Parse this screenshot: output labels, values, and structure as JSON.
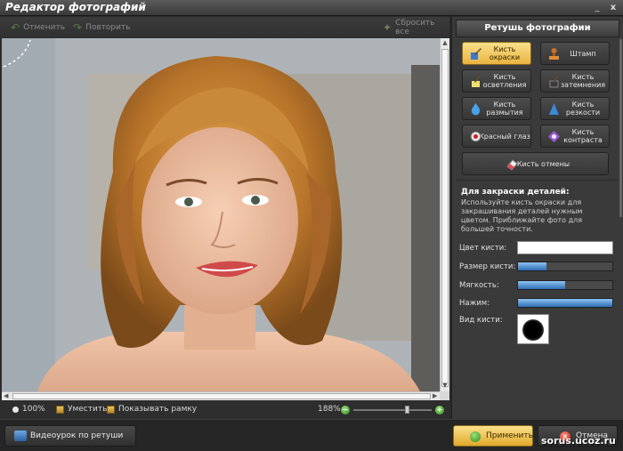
{
  "window": {
    "title": "Редактор фотографий",
    "minimize": "_",
    "close": "x"
  },
  "toolbar": {
    "undo": "Отменить",
    "redo": "Повторить",
    "reset": "Сбросить все"
  },
  "status": {
    "zoom_100": "100%",
    "fit": "Уместить",
    "show_frame": "Показывать рамку",
    "zoom_value": "188%",
    "zoom_level_fraction": 0.7
  },
  "bottom": {
    "video_tutorial": "Видеоурок по ретуши",
    "apply": "Применить",
    "cancel": "Отмена",
    "watermark": "sorus.ucoz.ru"
  },
  "panel": {
    "title": "Ретушь фотографии",
    "tools": [
      {
        "label": "Кисть окраски",
        "icon": "paint-brush-icon",
        "active": true
      },
      {
        "label": "Штамп",
        "icon": "stamp-icon",
        "active": false
      },
      {
        "label": "Кисть осветления",
        "icon": "lighten-brush-icon",
        "active": false
      },
      {
        "label": "Кисть затемнения",
        "icon": "darken-brush-icon",
        "active": false
      },
      {
        "label": "Кисть размытия",
        "icon": "blur-drop-icon",
        "active": false
      },
      {
        "label": "Кисть резкости",
        "icon": "sharpen-cone-icon",
        "active": false
      },
      {
        "label": "Красный глаз",
        "icon": "red-eye-icon",
        "active": false
      },
      {
        "label": "Кисть контраста",
        "icon": "contrast-icon",
        "active": false
      },
      {
        "label": "Кисть отмены",
        "icon": "eraser-icon",
        "active": false
      }
    ],
    "help_title": "Для закраски деталей:",
    "help_text": "Используйте кисть окраски для закрашивания деталей нужным цветом. Приближайте фото для большей точности.",
    "props": {
      "color_label": "Цвет кисти:",
      "color_value": "#ffffff",
      "size_label": "Размер кисти:",
      "size_fraction": 0.3,
      "softness_label": "Мягкость:",
      "softness_fraction": 0.5,
      "pressure_label": "Нажим:",
      "pressure_fraction": 1.0,
      "shape_label": "Вид кисти:"
    }
  },
  "colors": {
    "accent": "#e9b440",
    "bar_fill": "#2c6db4",
    "panel_bg": "#3a3a3a"
  }
}
